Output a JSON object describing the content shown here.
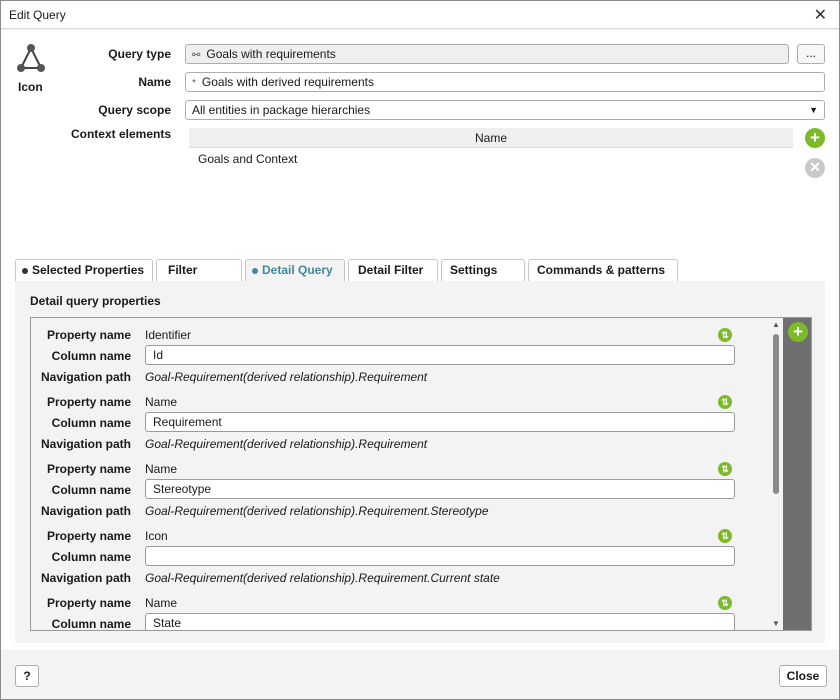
{
  "window": {
    "title": "Edit Query"
  },
  "header": {
    "icon_label": "Icon",
    "query_type_label": "Query type",
    "query_type_value": "Goals with requirements",
    "browse_label": "...",
    "name_label": "Name",
    "name_marker": "*",
    "name_value": "Goals with derived requirements",
    "scope_label": "Query scope",
    "scope_value": "All entities in package hierarchies",
    "context_label": "Context elements",
    "context_column": "Name",
    "context_rows": [
      "Goals and Context"
    ]
  },
  "tabs": [
    {
      "label": "Selected Properties",
      "dot": true
    },
    {
      "label": "Filter",
      "dot": false
    },
    {
      "label": "Detail Query",
      "dot": true,
      "active": true
    },
    {
      "label": "Detail Filter",
      "dot": false
    },
    {
      "label": "Settings",
      "dot": false
    },
    {
      "label": "Commands & patterns",
      "dot": false
    }
  ],
  "detail": {
    "title": "Detail query properties",
    "labels": {
      "property": "Property name",
      "column": "Column name",
      "navigation": "Navigation path"
    },
    "items": [
      {
        "property": "Identifier",
        "column": "Id",
        "navigation": "Goal-Requirement(derived relationship).Requirement"
      },
      {
        "property": "Name",
        "column": "Requirement",
        "navigation": "Goal-Requirement(derived relationship).Requirement"
      },
      {
        "property": "Name",
        "column": "Stereotype",
        "navigation": "Goal-Requirement(derived relationship).Requirement.Stereotype"
      },
      {
        "property": "Icon",
        "column": "",
        "navigation": "Goal-Requirement(derived relationship).Requirement.Current state"
      },
      {
        "property": "Name",
        "column": "State",
        "navigation": ""
      }
    ]
  },
  "footer": {
    "help_label": "?",
    "close_label": "Close"
  },
  "colors": {
    "accent": "#3f8a9a",
    "green": "#7cba2a"
  }
}
